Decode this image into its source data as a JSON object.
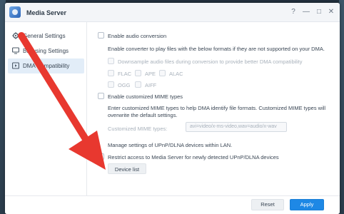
{
  "window": {
    "title": "Media Server",
    "buttons": [
      "?",
      "—",
      "□",
      "✕"
    ]
  },
  "sidebar": {
    "items": [
      {
        "label": "General Settings",
        "icon": "gear-icon",
        "active": false
      },
      {
        "label": "Browsing Settings",
        "icon": "monitor-icon",
        "active": false
      },
      {
        "label": "DMA Compatibility",
        "icon": "play-icon",
        "active": true
      }
    ]
  },
  "audio": {
    "enable_label": "Enable audio conversion",
    "description": "Enable converter to play files with the below formats if they are not supported on your DMA.",
    "downsample_label": "Downsample audio files during conversion to provide better DMA compatibility",
    "formats": [
      "FLAC",
      "APE",
      "ALAC",
      "OGG",
      "AIFF"
    ]
  },
  "mime": {
    "enable_label": "Enable customized MIME types",
    "description": "Enter customized MIME types to help DMA identify file formats. Customized MIME types will overwrite the default settings.",
    "field_label": "Customized MIME types:",
    "field_placeholder": "avi=video/x-ms-video,wav=audio/x-wav"
  },
  "upnp": {
    "manage_label": "Manage settings of UPnP/DLNA devices within LAN.",
    "restrict_label": "Restrict access to Media Server for newly detected UPnP/DLNA devices",
    "device_list_label": "Device list"
  },
  "footer": {
    "reset_label": "Reset",
    "apply_label": "Apply"
  },
  "colors": {
    "accent": "#1e88e5",
    "arrow": "#e8382f",
    "active_nav": "#e2edf8"
  }
}
